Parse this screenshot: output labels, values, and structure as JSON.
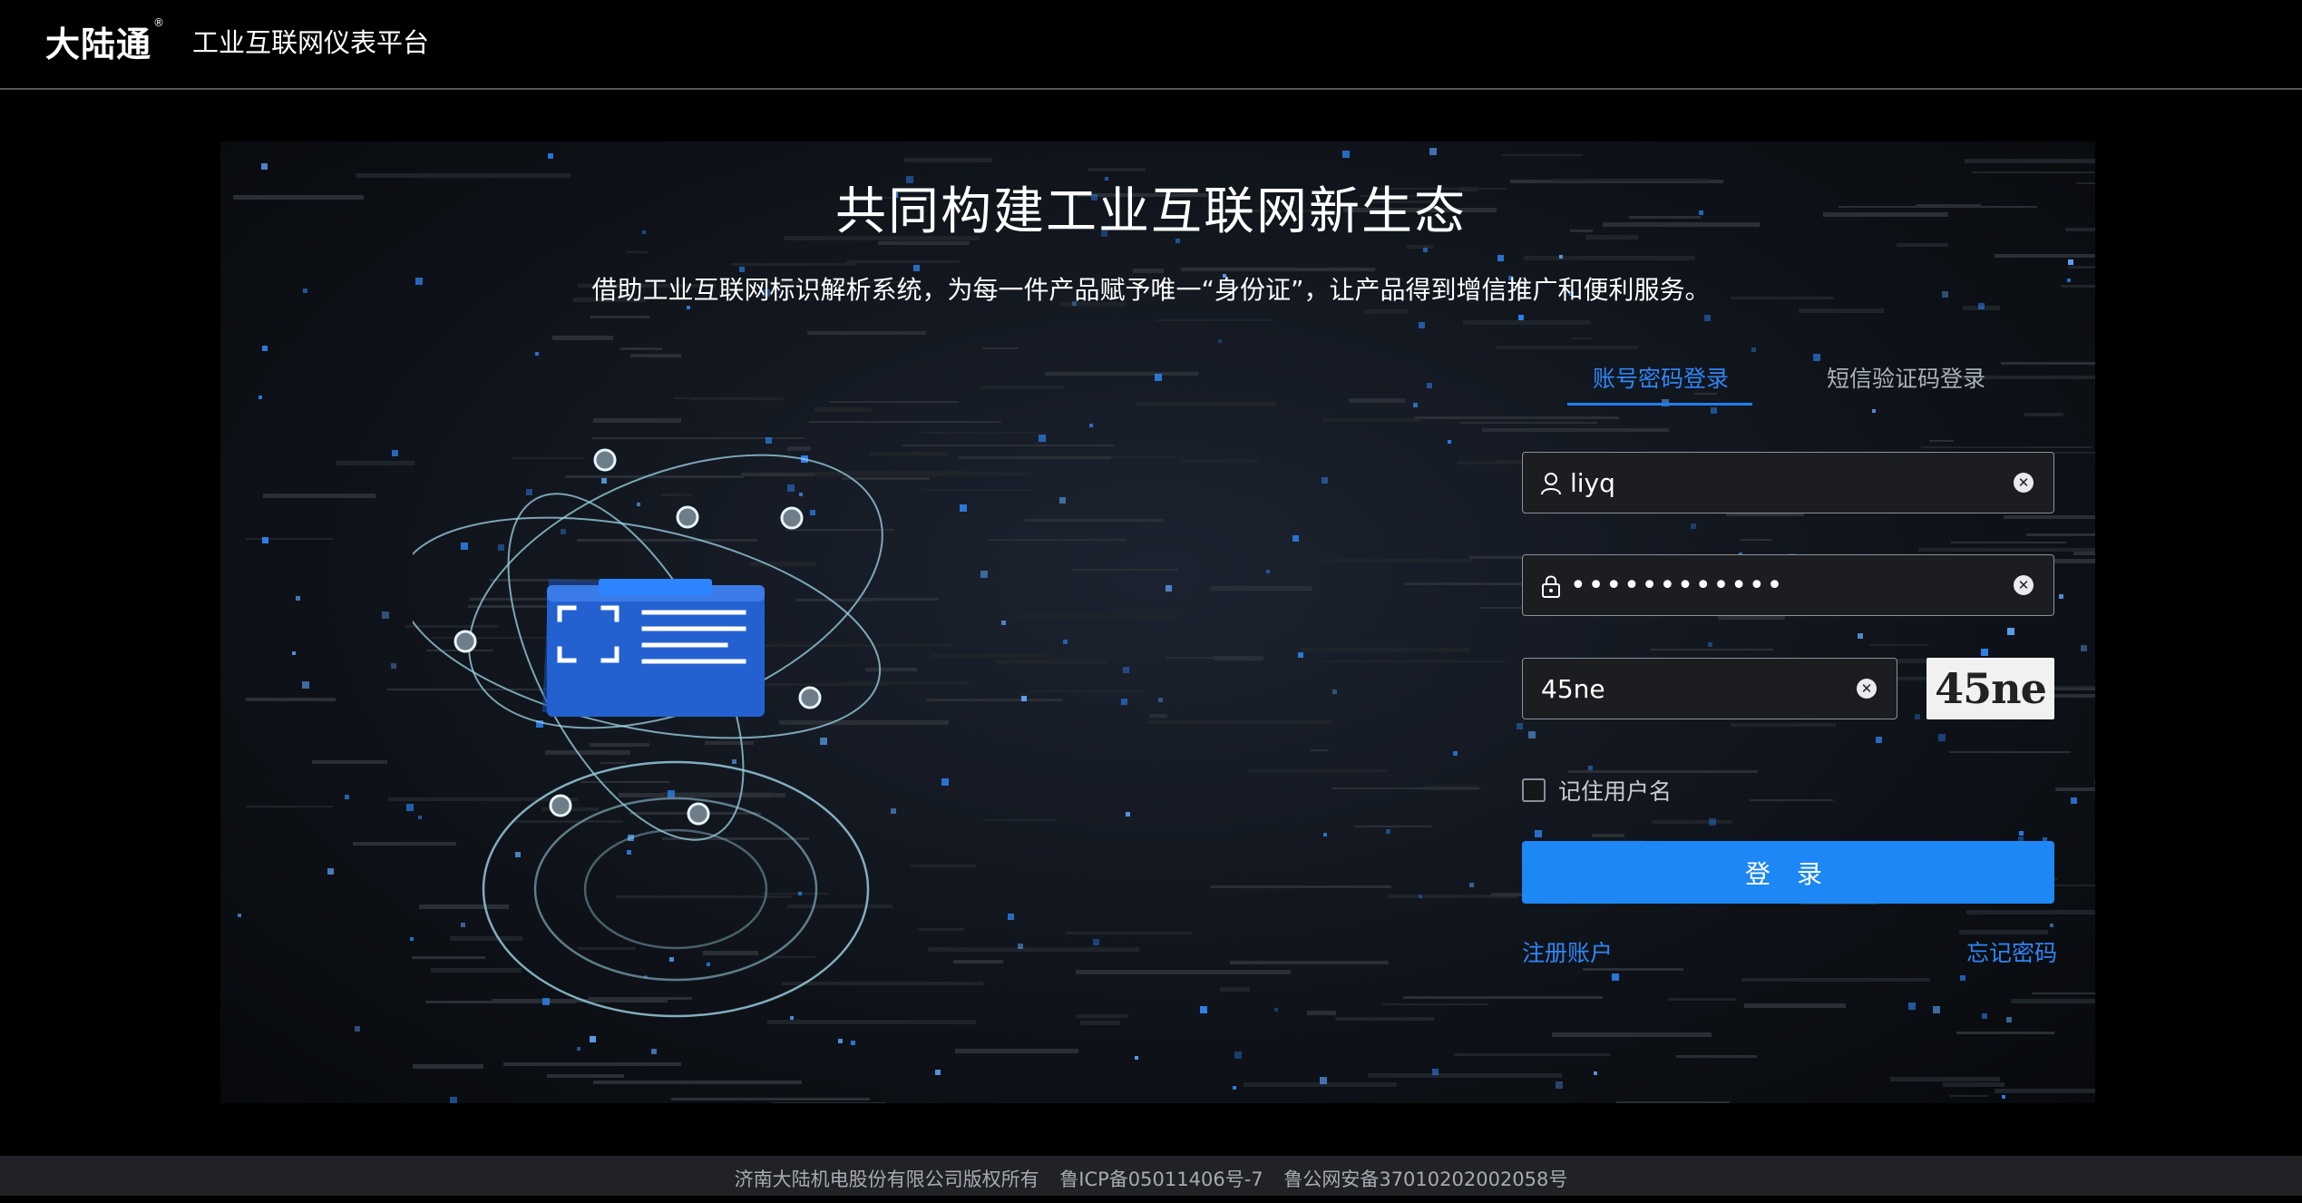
{
  "header": {
    "logo": "大陆通",
    "logo_mark": "®",
    "platform_name": "工业互联网仪表平台"
  },
  "hero": {
    "title": "共同构建工业互联网新生态",
    "subtitle": "借助工业互联网标识解析系统，为每一件产品赋予唯一“身份证”，让产品得到增信推广和便利服务。"
  },
  "login": {
    "tabs": [
      {
        "label": "账号密码登录",
        "active": true
      },
      {
        "label": "短信验证码登录",
        "active": false
      }
    ],
    "username": "liyq",
    "password": "••••••••••••",
    "captcha_input": "45ne",
    "captcha_image_text": "45ne",
    "remember_label": "记住用户名",
    "remember_checked": false,
    "submit_label": "登 录",
    "register_link": "注册账户",
    "forgot_link": "忘记密码"
  },
  "footer": {
    "copyright": "济南大陆机电股份有限公司版权所有",
    "icp": "鲁ICP备05011406号-7",
    "police": "鲁公网安备37010202002058号"
  },
  "colors": {
    "accent": "#1c87f5",
    "background": "#000000"
  },
  "icons": {
    "user_field": "user-icon",
    "password_field": "lock-icon",
    "clear": "clear-icon"
  }
}
